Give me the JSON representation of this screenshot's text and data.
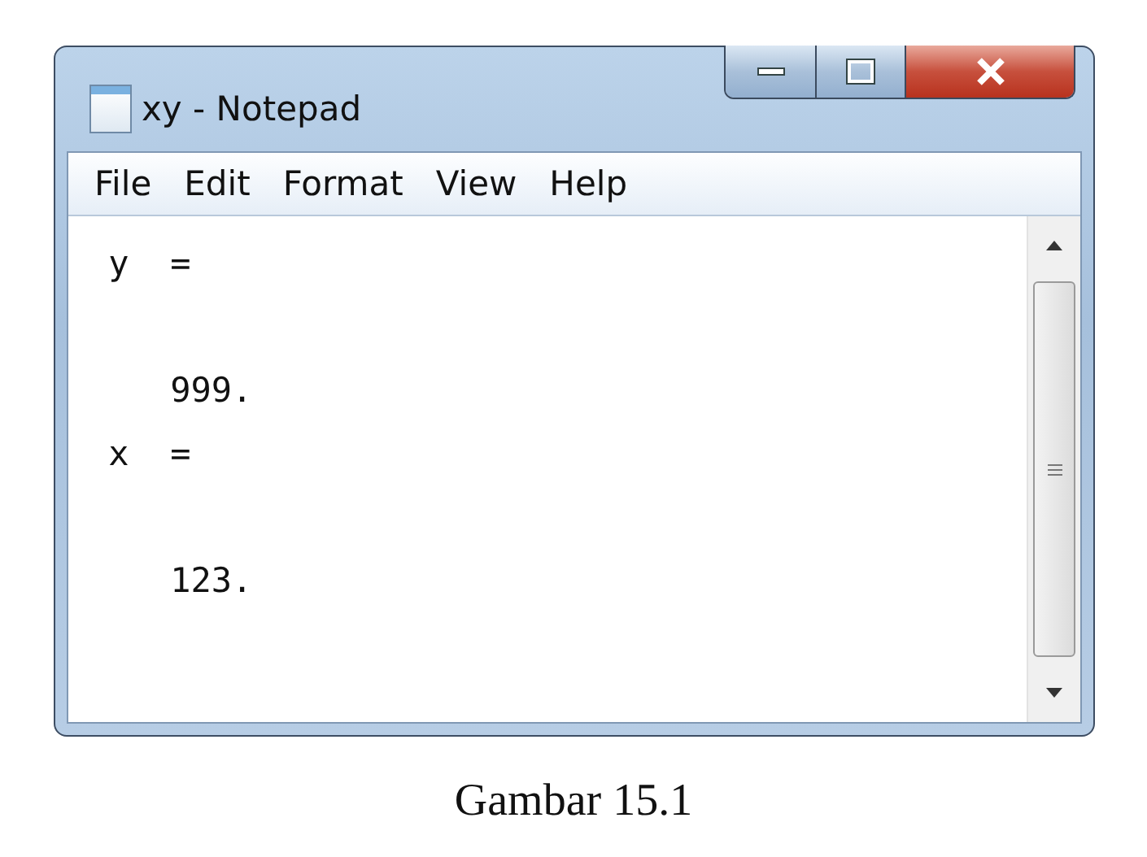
{
  "window": {
    "title": "xy - Notepad"
  },
  "menu": [
    "File",
    "Edit",
    "Format",
    "View",
    "Help"
  ],
  "editor": {
    "text": " y  =\n\n    999.\n x  =\n\n    123."
  },
  "caption": "Gambar 15.1"
}
